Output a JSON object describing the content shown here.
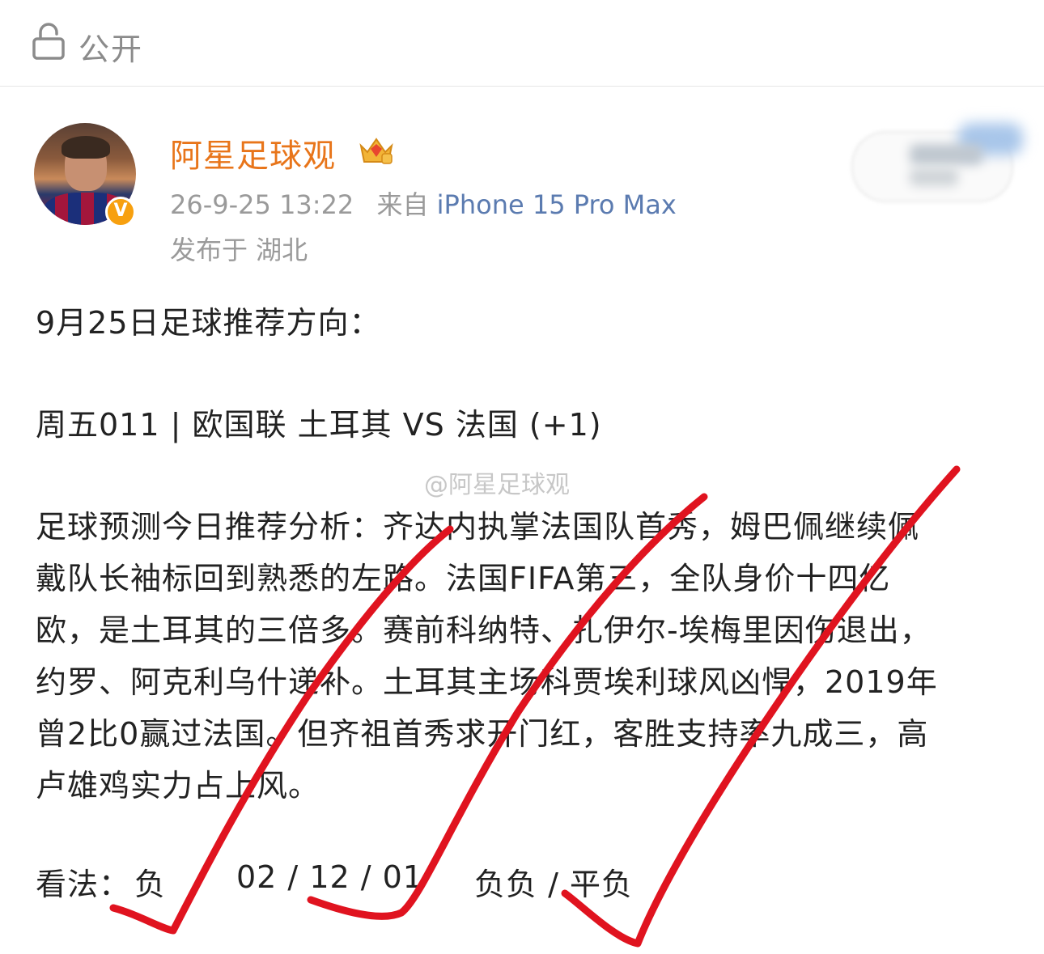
{
  "header": {
    "visibility_label": "公开"
  },
  "author": {
    "name": "阿星足球观",
    "verified_mark": "V",
    "time": "26-9-25 13:22",
    "source_prefix": "来自",
    "source_device": "iPhone 15 Pro Max",
    "location": "发布于 湖北"
  },
  "post": {
    "line1": "9月25日足球推荐方向：",
    "line2": "周五011 | 欧国联 土耳其 VS 法国 (+1)",
    "analysis_lines": [
      "足球预测今日推荐分析：齐达内执掌法国队首秀，姆巴佩继续佩",
      "戴队长袖标回到熟悉的左路。法国FIFA第三，全队身价十四亿",
      "欧，是土耳其的三倍多。赛前科纳特、扎伊尔-埃梅里因伤退出，",
      "约罗、阿克利乌什递补。土耳其主场科贾埃利球风凶悍，2019年",
      "曾2比0赢过法国。但齐祖首秀求开门红，客胜支持率九成三，高",
      "卢雄鸡实力占上风。"
    ],
    "verdict_label": "看法：",
    "verdict_1": "负",
    "verdict_2": "02 / 12 / 01",
    "verdict_3": "负负 / 平负"
  },
  "watermark": "@阿星足球观",
  "colors": {
    "username": "#e8751a",
    "source": "#5b7bb0",
    "check": "#e0131f"
  }
}
